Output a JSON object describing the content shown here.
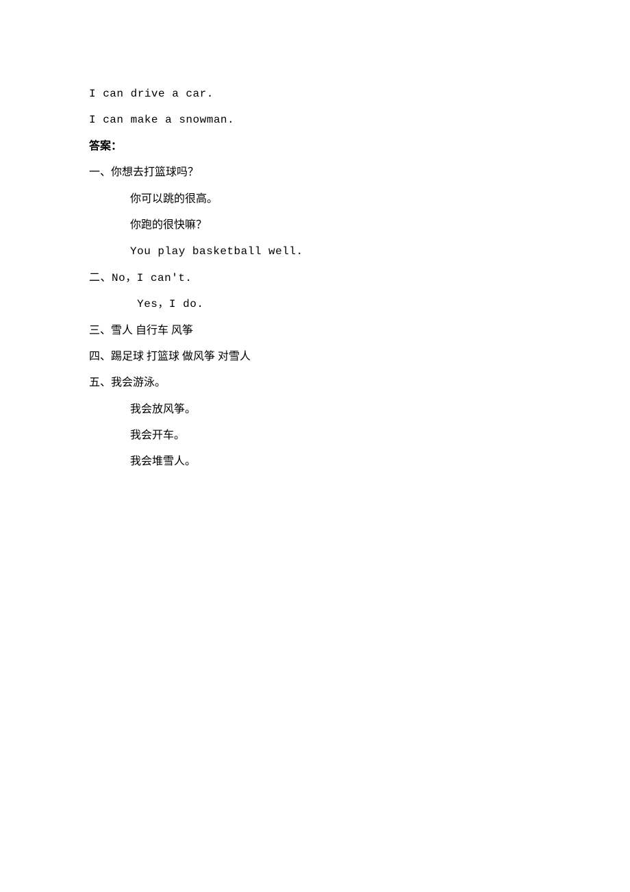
{
  "lines": [
    {
      "text": "I can drive a car.",
      "cls": "line mono"
    },
    {
      "text": "I can make a snowman.",
      "cls": "line mono"
    },
    {
      "text": "答案：",
      "cls": "line bold"
    },
    {
      "text": "一、你想去打篮球吗？",
      "cls": "line"
    },
    {
      "text": "你可以跳的很高。",
      "cls": "line indent1"
    },
    {
      "text": "你跑的很快嘛？",
      "cls": "line indent1"
    },
    {
      "text": "You play basketball well.",
      "cls": "line mono indent1"
    },
    {
      "text": "二、No，I can't.",
      "cls": "line mono"
    },
    {
      "text": " Yes，I do.",
      "cls": "line mono indent1"
    },
    {
      "text": "三、雪人 自行车 风筝",
      "cls": "line"
    },
    {
      "text": "四、踢足球 打篮球 做风筝 对雪人",
      "cls": "line"
    },
    {
      "text": "五、我会游泳。",
      "cls": "line"
    },
    {
      "text": "我会放风筝。",
      "cls": "line indent1"
    },
    {
      "text": "我会开车。",
      "cls": "line indent1"
    },
    {
      "text": "我会堆雪人。",
      "cls": "line indent1"
    }
  ]
}
